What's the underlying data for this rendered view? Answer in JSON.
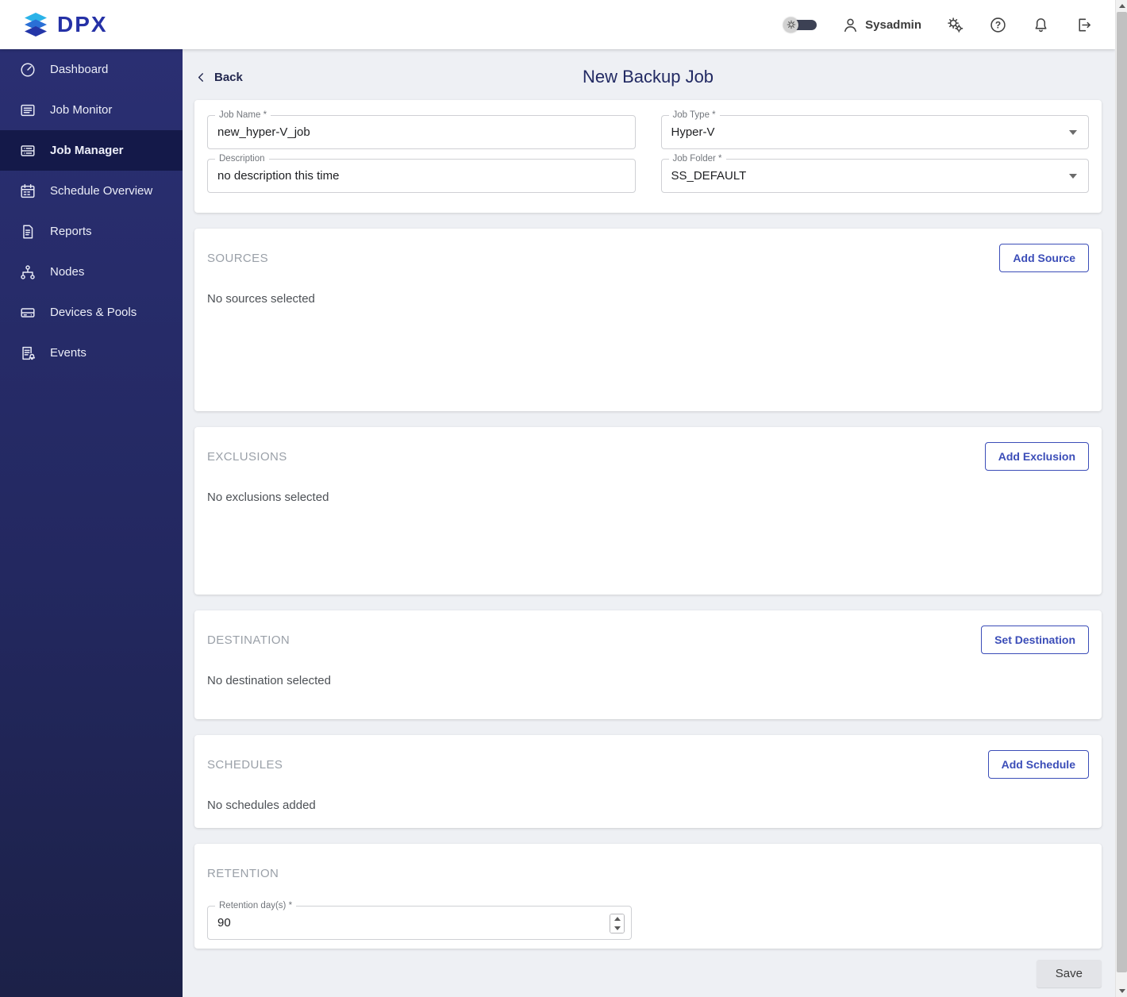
{
  "colors": {
    "accent": "#3b4db8",
    "sidebar_bg": "#232860",
    "brand": "#2531a6"
  },
  "header": {
    "logo_text": "DPX",
    "user_name": "Sysadmin"
  },
  "sidebar": {
    "items": [
      {
        "label": "Dashboard"
      },
      {
        "label": "Job Monitor"
      },
      {
        "label": "Job Manager"
      },
      {
        "label": "Schedule Overview"
      },
      {
        "label": "Reports"
      },
      {
        "label": "Nodes"
      },
      {
        "label": "Devices & Pools"
      },
      {
        "label": "Events"
      }
    ]
  },
  "page": {
    "back_label": "Back",
    "title": "New Backup Job",
    "save_label": "Save"
  },
  "form": {
    "job_name": {
      "label": "Job Name *",
      "value": "new_hyper-V_job"
    },
    "job_type": {
      "label": "Job Type *",
      "value": "Hyper-V"
    },
    "description": {
      "label": "Description",
      "value": "no description this time"
    },
    "job_folder": {
      "label": "Job Folder *",
      "value": "SS_DEFAULT"
    }
  },
  "sections": {
    "sources": {
      "title": "SOURCES",
      "button_label": "Add Source",
      "empty_text": "No sources selected"
    },
    "exclusions": {
      "title": "EXCLUSIONS",
      "button_label": "Add Exclusion",
      "empty_text": "No exclusions selected"
    },
    "destination": {
      "title": "DESTINATION",
      "button_label": "Set Destination",
      "empty_text": "No destination selected"
    },
    "schedules": {
      "title": "SCHEDULES",
      "button_label": "Add Schedule",
      "empty_text": "No schedules added"
    },
    "retention": {
      "title": "RETENTION",
      "field_label": "Retention day(s) *",
      "value": "90"
    }
  }
}
